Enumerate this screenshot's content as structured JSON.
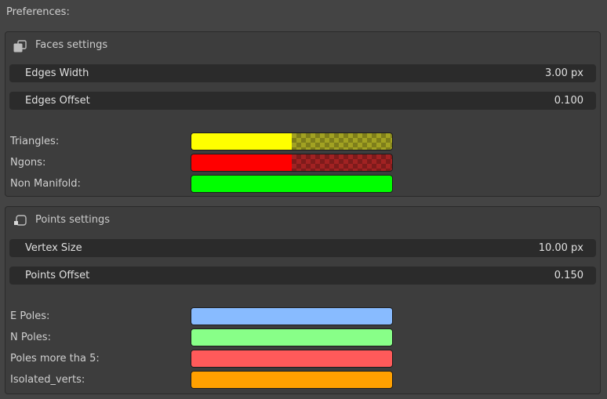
{
  "title": "Preferences:",
  "faces": {
    "header": "Faces settings",
    "icon": "face-icon",
    "fields": [
      {
        "label": "Edges Width",
        "value": "3.00 px"
      },
      {
        "label": "Edges Offset",
        "value": "0.100"
      }
    ],
    "colors": [
      {
        "label": "Triangles:",
        "color": "#ffff00",
        "alpha": 0.5
      },
      {
        "label": "Ngons:",
        "color": "#ff0000",
        "alpha": 0.5
      },
      {
        "label": "Non Manifold:",
        "color": "#00ff00",
        "alpha": 1.0
      }
    ]
  },
  "points": {
    "header": "Points settings",
    "icon": "vertex-icon",
    "fields": [
      {
        "label": "Vertex Size",
        "value": "10.00 px"
      },
      {
        "label": "Points Offset",
        "value": "0.150"
      }
    ],
    "colors": [
      {
        "label": "E Poles:",
        "color": "#88bbff",
        "alpha": 1.0
      },
      {
        "label": "N Poles:",
        "color": "#88ff88",
        "alpha": 1.0
      },
      {
        "label": "Poles more tha 5:",
        "color": "#ff5a5a",
        "alpha": 1.0
      },
      {
        "label": "Isolated_verts:",
        "color": "#ffa000",
        "alpha": 1.0
      }
    ]
  }
}
